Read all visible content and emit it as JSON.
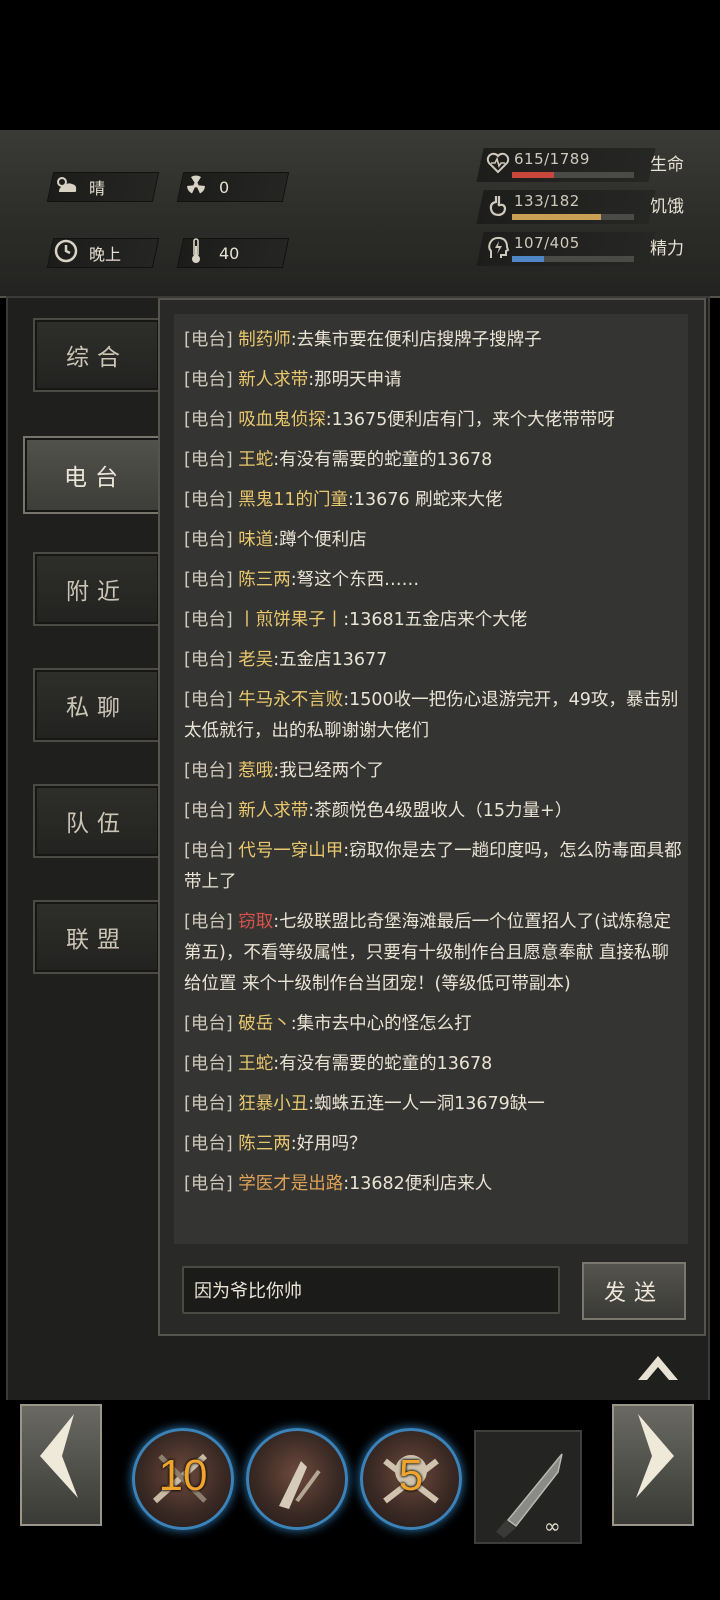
{
  "status": {
    "weather": "晴",
    "radiation": "0",
    "time_of_day": "晚上",
    "temperature": "40",
    "bars": [
      {
        "value": "615/1789",
        "label": "生命",
        "fill": 0.344,
        "color": "#c9473a",
        "icon": "heart-icon"
      },
      {
        "value": "133/182",
        "label": "饥饿",
        "fill": 0.731,
        "color": "#caa055",
        "icon": "stomach-icon"
      },
      {
        "value": "107/405",
        "label": "精力",
        "fill": 0.264,
        "color": "#4f86c6",
        "icon": "energy-head-icon"
      }
    ]
  },
  "tabs": [
    {
      "label": "综合",
      "active": false
    },
    {
      "label": "电台",
      "active": true
    },
    {
      "label": "附近",
      "active": false
    },
    {
      "label": "私聊",
      "active": false
    },
    {
      "label": "队伍",
      "active": false
    },
    {
      "label": "联盟",
      "active": false
    }
  ],
  "chat": {
    "channel_tag": "[电台]",
    "messages": [
      {
        "name": "制药师",
        "text": ":去集市要在便利店搜牌子搜牌子",
        "color": "gold"
      },
      {
        "name": "新人求带",
        "text": ":那明天申请",
        "color": "gold"
      },
      {
        "name": "吸血鬼侦探",
        "text": ":13675便利店有门，来个大佬带带呀",
        "color": "gold"
      },
      {
        "name": "王蛇",
        "text": ":有没有需要的蛇童的13678",
        "color": "gold"
      },
      {
        "name": "黑鬼11的门童",
        "text": ":13676 刷蛇来大佬",
        "color": "gold"
      },
      {
        "name": "味道",
        "text": ":蹲个便利店",
        "color": "gold"
      },
      {
        "name": "陈三两",
        "text": ":弩这个东西……",
        "color": "gold"
      },
      {
        "name": "丨煎饼果子丨",
        "text": ":13681五金店来个大佬",
        "color": "gold"
      },
      {
        "name": "老吴",
        "text": ":五金店13677",
        "color": "gold"
      },
      {
        "name": "牛马永不言败",
        "text": ":1500收一把伤心退游完开，49攻，暴击别太低就行，出的私聊谢谢大佬们",
        "color": "gold"
      },
      {
        "name": "惹哦",
        "text": ":我已经两个了",
        "color": "gold"
      },
      {
        "name": "新人求带",
        "text": ":茶颜悦色4级盟收人（15力量+）",
        "color": "gold"
      },
      {
        "name": "代号一穿山甲",
        "text": ":窃取你是去了一趟印度吗，怎么防毒面具都带上了",
        "color": "gold"
      },
      {
        "name": "窃取",
        "text": ":七级联盟比奇堡海滩最后一个位置招人了(试炼稳定第五)，不看等级属性，只要有十级制作台且愿意奉献 直接私聊给位置 来个十级制作台当团宠！(等级低可带副本)",
        "color": "red"
      },
      {
        "name": "破岳丶",
        "text": ":集市去中心的怪怎么打",
        "color": "gold"
      },
      {
        "name": "王蛇",
        "text": ":有没有需要的蛇童的13678",
        "color": "gold"
      },
      {
        "name": "狂暴小丑",
        "text": ":蜘蛛五连一人一洞13679缺一",
        "color": "gold"
      },
      {
        "name": "陈三两",
        "text": ":好用吗？",
        "color": "gold"
      },
      {
        "name": "学医才是出路",
        "text": ":13682便利店来人",
        "color": "orange"
      }
    ],
    "input_value": "因为爷比你帅",
    "send_label": "发送"
  },
  "hotbar": {
    "slot1_count": "10",
    "slot3_count": "5",
    "weapon_durability": "∞"
  }
}
